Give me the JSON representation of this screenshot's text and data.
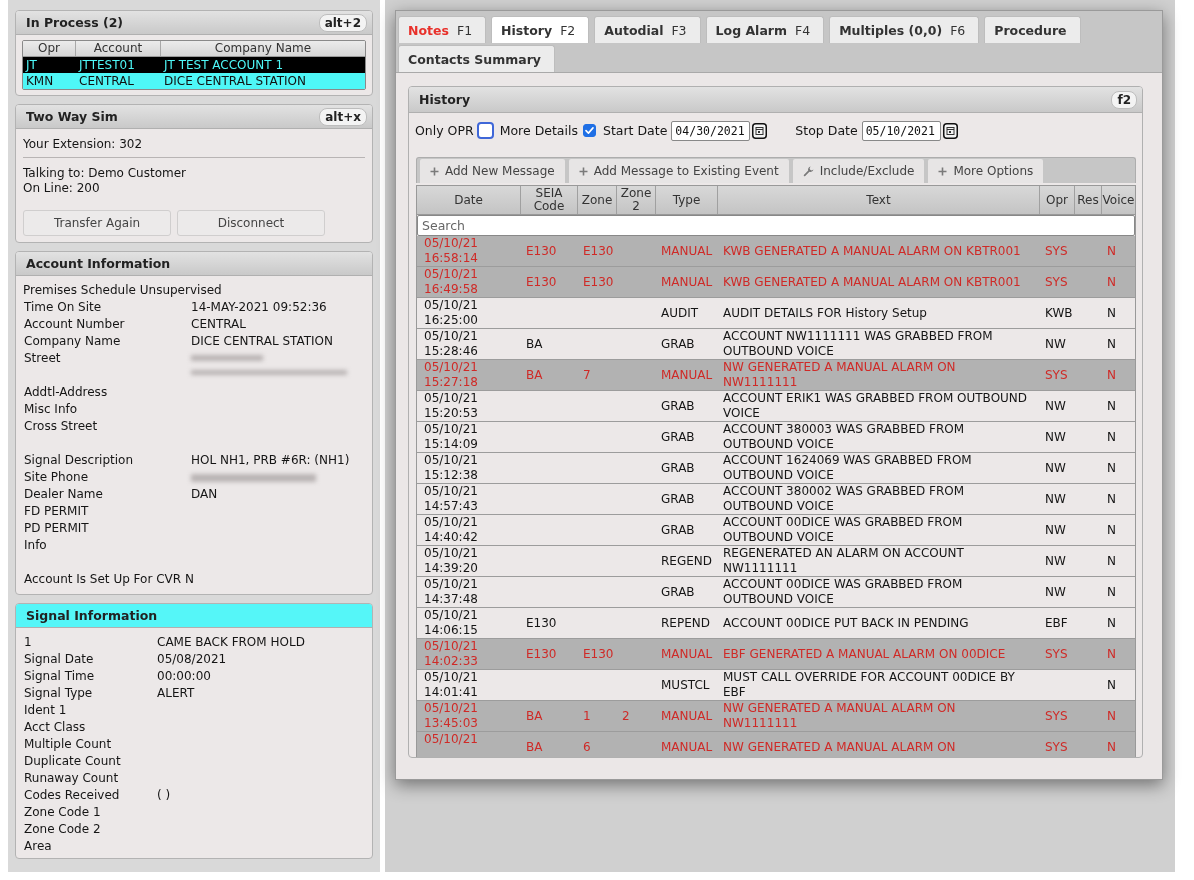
{
  "in_process": {
    "title": "In Process (2)",
    "shortcut": "alt+2",
    "active": false,
    "columns": [
      "Opr",
      "Account",
      "Company Name"
    ],
    "rows": [
      {
        "cells": [
          "JT",
          "JTTEST01",
          "JT TEST ACCOUNT 1"
        ],
        "focused": true,
        "selected": false
      },
      {
        "cells": [
          "KMN",
          "CENTRAL",
          "DICE CENTRAL STATION"
        ],
        "focused": false,
        "selected": true
      }
    ]
  },
  "two_way_sim": {
    "title": "Two Way Sim",
    "shortcut": "alt+x",
    "active": false,
    "extension": "Your Extension: 302",
    "talking_to": "Talking to: Demo Customer",
    "on_line": "On Line: 200",
    "buttons": [
      "Transfer Again",
      "Disconnect"
    ]
  },
  "account_information": {
    "title": "Account Information",
    "active": false,
    "groups": [
      [
        {
          "kind": "note",
          "label": "Premises Schedule Unsupervised"
        },
        {
          "kind": "pair",
          "label": "Time On Site",
          "value": "14-MAY-2021 09:52:36"
        },
        {
          "kind": "pair",
          "label": "Account Number",
          "value": "CENTRAL"
        },
        {
          "kind": "pair",
          "label": "Company Name",
          "value": "DICE CENTRAL STATION"
        },
        {
          "kind": "blurred_multiline",
          "label": "Street"
        },
        {
          "kind": "pair",
          "label": "Addtl-Address"
        },
        {
          "kind": "pair",
          "label": "Misc Info"
        },
        {
          "kind": "pair",
          "label": "Cross Street"
        }
      ],
      [
        {
          "kind": "pair",
          "label": "Signal Description",
          "value": "HOL NH1, PRB #6R: (NH1)"
        },
        {
          "kind": "blurred",
          "label": "Site Phone"
        },
        {
          "kind": "pair",
          "label": "Dealer Name",
          "value": "DAN"
        },
        {
          "kind": "pair",
          "label": "FD PERMIT"
        },
        {
          "kind": "pair",
          "label": "PD PERMIT"
        },
        {
          "kind": "pair",
          "label": "Info"
        }
      ],
      [
        {
          "kind": "inline",
          "label": "Account Is Set Up For CVR",
          "value": "N"
        }
      ]
    ]
  },
  "signal_information": {
    "title": "Signal Information",
    "active": true,
    "fields": [
      {
        "label": "1",
        "value": "CAME BACK FROM HOLD"
      },
      {
        "label": "Signal Date",
        "value": "05/08/2021"
      },
      {
        "label": "Signal Time",
        "value": "00:00:00"
      },
      {
        "label": "Signal Type",
        "value": "ALERT"
      },
      {
        "label": "Ident 1"
      },
      {
        "label": "Acct Class"
      },
      {
        "label": "Multiple Count"
      },
      {
        "label": "Duplicate Count"
      },
      {
        "label": "Runaway Count"
      },
      {
        "label": "Codes Received",
        "value": "( )"
      },
      {
        "label": "Zone Code 1"
      },
      {
        "label": "Zone Code 2"
      },
      {
        "label": "Area"
      }
    ]
  },
  "tabs": [
    {
      "label": "Notes",
      "key": "F1",
      "selected": false,
      "alert": true
    },
    {
      "label": "History",
      "key": "F2",
      "selected": true,
      "alert": false
    },
    {
      "label": "Autodial",
      "key": "F3",
      "selected": false,
      "alert": false
    },
    {
      "label": "Log Alarm",
      "key": "F4",
      "selected": false,
      "alert": false
    },
    {
      "label": "Multiples (0,0)",
      "key": "F6",
      "selected": false,
      "alert": false
    },
    {
      "label": "Procedure",
      "selected": false,
      "alert": false
    },
    {
      "label": "Contacts Summary",
      "selected": false,
      "alert": false
    }
  ],
  "history": {
    "title": "History",
    "shortcut": "f2",
    "options": [
      {
        "label": "Only OPR",
        "checked": false
      },
      {
        "label": "More Details",
        "checked": true
      }
    ],
    "dates": [
      {
        "label": "Start Date",
        "value": "04/30/2021"
      },
      {
        "label": "Stop Date",
        "value": "05/10/2021"
      }
    ],
    "toolbar": [
      {
        "label": "Add New Message",
        "kind": "add"
      },
      {
        "label": "Add Message to Existing Event",
        "kind": "add"
      },
      {
        "label": "Include/Exclude",
        "kind": "tool"
      },
      {
        "label": "More Options",
        "kind": "add"
      }
    ],
    "table": {
      "columns": [
        "Date",
        "SEIA Code",
        "Zone",
        "Zone 2",
        "Type",
        "Text",
        "Opr",
        "Res",
        "Voice"
      ],
      "search": {
        "placeholder": "Search"
      },
      "rows": [
        {
          "alarm": true,
          "date": "05/10/21",
          "time": "16:58:14",
          "seia_code": "E130",
          "zone": "E130",
          "type": "MANUAL",
          "text": "KWB GENERATED A MANUAL ALARM ON KBTR001",
          "opr": "SYS",
          "voice": "N"
        },
        {
          "alarm": true,
          "date": "05/10/21",
          "time": "16:49:58",
          "seia_code": "E130",
          "zone": "E130",
          "type": "MANUAL",
          "text": "KWB GENERATED A MANUAL ALARM ON KBTR001",
          "opr": "SYS",
          "voice": "N"
        },
        {
          "alarm": false,
          "date": "05/10/21",
          "time": "16:25:00",
          "type": "AUDIT",
          "text": "AUDIT DETAILS FOR History Setup",
          "opr": "KWB",
          "voice": "N"
        },
        {
          "alarm": false,
          "date": "05/10/21",
          "time": "15:28:46",
          "seia_code": "BA",
          "type": "GRAB",
          "text": "ACCOUNT NW1111111 WAS GRABBED FROM OUTBOUND VOICE",
          "opr": "NW",
          "voice": "N"
        },
        {
          "alarm": true,
          "date": "05/10/21",
          "time": "15:27:18",
          "seia_code": "BA",
          "zone": "7",
          "type": "MANUAL",
          "text": "NW GENERATED A MANUAL ALARM ON NW1111111",
          "opr": "SYS",
          "voice": "N"
        },
        {
          "alarm": false,
          "date": "05/10/21",
          "time": "15:20:53",
          "type": "GRAB",
          "text": "ACCOUNT ERIK1 WAS GRABBED FROM OUTBOUND VOICE",
          "opr": "NW",
          "voice": "N"
        },
        {
          "alarm": false,
          "date": "05/10/21",
          "time": "15:14:09",
          "type": "GRAB",
          "text": "ACCOUNT 380003 WAS GRABBED FROM OUTBOUND VOICE",
          "opr": "NW",
          "voice": "N"
        },
        {
          "alarm": false,
          "date": "05/10/21",
          "time": "15:12:38",
          "type": "GRAB",
          "text": "ACCOUNT 1624069 WAS GRABBED FROM OUTBOUND VOICE",
          "opr": "NW",
          "voice": "N"
        },
        {
          "alarm": false,
          "date": "05/10/21",
          "time": "14:57:43",
          "type": "GRAB",
          "text": "ACCOUNT 380002 WAS GRABBED FROM OUTBOUND VOICE",
          "opr": "NW",
          "voice": "N"
        },
        {
          "alarm": false,
          "date": "05/10/21",
          "time": "14:40:42",
          "type": "GRAB",
          "text": "ACCOUNT 00DICE WAS GRABBED FROM OUTBOUND VOICE",
          "opr": "NW",
          "voice": "N"
        },
        {
          "alarm": false,
          "date": "05/10/21",
          "time": "14:39:20",
          "type": "REGEND",
          "text": "REGENERATED AN ALARM ON ACCOUNT NW1111111",
          "opr": "NW",
          "voice": "N"
        },
        {
          "alarm": false,
          "date": "05/10/21",
          "time": "14:37:48",
          "type": "GRAB",
          "text": "ACCOUNT 00DICE WAS GRABBED FROM OUTBOUND VOICE",
          "opr": "NW",
          "voice": "N"
        },
        {
          "alarm": false,
          "date": "05/10/21",
          "time": "14:06:15",
          "seia_code": "E130",
          "type": "REPEND",
          "text": "ACCOUNT 00DICE PUT BACK IN PENDING",
          "opr": "EBF",
          "voice": "N"
        },
        {
          "alarm": true,
          "date": "05/10/21",
          "time": "14:02:33",
          "seia_code": "E130",
          "zone": "E130",
          "type": "MANUAL",
          "text": "EBF GENERATED A MANUAL ALARM ON 00DICE",
          "opr": "SYS",
          "voice": "N"
        },
        {
          "alarm": false,
          "date": "05/10/21",
          "time": "14:01:41",
          "type": "MUSTCL",
          "text": "MUST CALL OVERRIDE FOR ACCOUNT 00DICE BY EBF",
          "voice": "N"
        },
        {
          "alarm": true,
          "date": "05/10/21",
          "time": "13:45:03",
          "seia_code": "BA",
          "zone": "1",
          "zone_2": "2",
          "type": "MANUAL",
          "text": "NW GENERATED A MANUAL ALARM ON NW1111111",
          "opr": "SYS",
          "voice": "N"
        },
        {
          "alarm": true,
          "date": "05/10/21",
          "seia_code": "BA",
          "zone": "6",
          "type": "MANUAL",
          "text": "NW GENERATED A MANUAL ALARM ON",
          "opr": "SYS",
          "voice": "N"
        }
      ]
    }
  }
}
